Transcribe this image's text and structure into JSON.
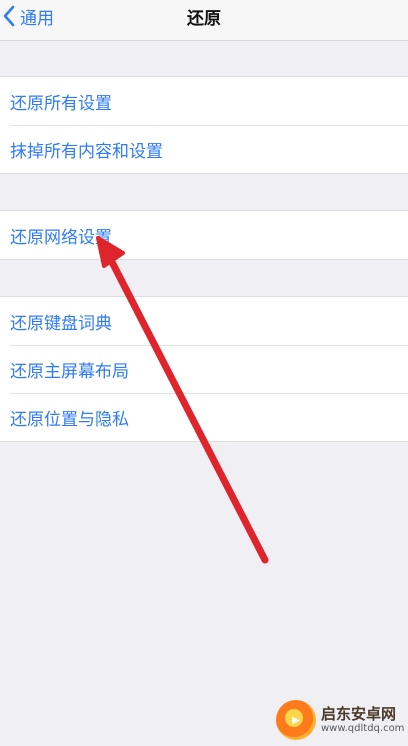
{
  "nav": {
    "back_label": "通用",
    "title": "还原"
  },
  "groups": [
    {
      "items": [
        {
          "label": "还原所有设置"
        },
        {
          "label": "抹掉所有内容和设置"
        }
      ]
    },
    {
      "items": [
        {
          "label": "还原网络设置"
        }
      ]
    },
    {
      "items": [
        {
          "label": "还原键盘词典"
        },
        {
          "label": "还原主屏幕布局"
        },
        {
          "label": "还原位置与隐私"
        }
      ]
    }
  ],
  "colors": {
    "accent": "#2f7cf6",
    "arrow": "#e0242b",
    "background": "#efeff4"
  },
  "watermark": {
    "name": "启东安卓网",
    "url": "www.qdltdq.com"
  }
}
